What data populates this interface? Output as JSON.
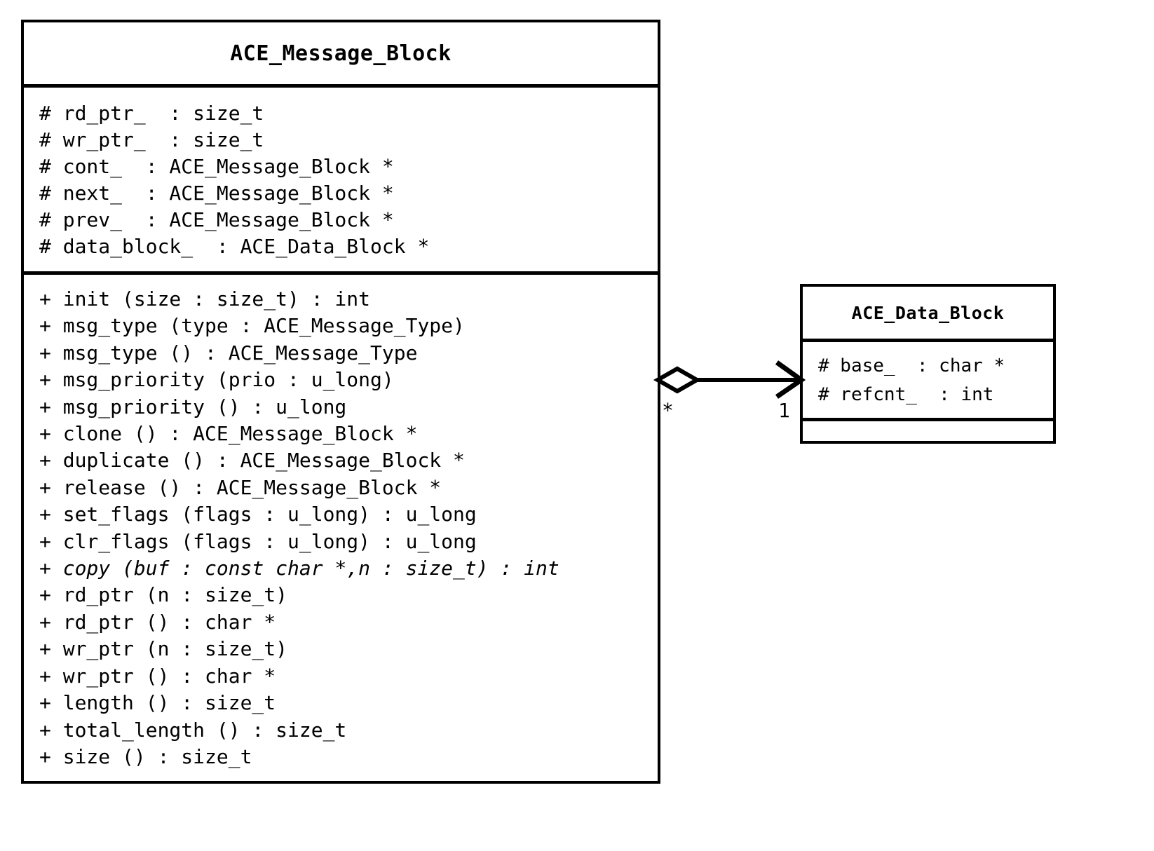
{
  "diagram": {
    "type": "uml-class-diagram",
    "background_color": "#ffffff",
    "line_color": "#000000"
  },
  "classes": {
    "message_block": {
      "name": "ACE_Message_Block",
      "attributes": [
        "# rd_ptr_  : size_t",
        "# wr_ptr_  : size_t",
        "# cont_  : ACE_Message_Block *",
        "# next_  : ACE_Message_Block *",
        "# prev_  : ACE_Message_Block *",
        "# data_block_  : ACE_Data_Block *"
      ],
      "operations": [
        {
          "text": "+ init (size : size_t) : int",
          "italic": false
        },
        {
          "text": "+ msg_type (type : ACE_Message_Type)",
          "italic": false
        },
        {
          "text": "+ msg_type () : ACE_Message_Type",
          "italic": false
        },
        {
          "text": "+ msg_priority (prio : u_long)",
          "italic": false
        },
        {
          "text": "+ msg_priority () : u_long",
          "italic": false
        },
        {
          "text": "+ clone () : ACE_Message_Block *",
          "italic": false
        },
        {
          "text": "+ duplicate () : ACE_Message_Block *",
          "italic": false
        },
        {
          "text": "+ release () : ACE_Message_Block *",
          "italic": false
        },
        {
          "text": "+ set_flags (flags : u_long) : u_long",
          "italic": false
        },
        {
          "text": "+ clr_flags (flags : u_long) : u_long",
          "italic": false
        },
        {
          "text": "+ copy (buf : const char *,n : size_t) : int",
          "italic": true
        },
        {
          "text": "+ rd_ptr (n : size_t)",
          "italic": false
        },
        {
          "text": "+ rd_ptr () : char *",
          "italic": false
        },
        {
          "text": "+ wr_ptr (n : size_t)",
          "italic": false
        },
        {
          "text": "+ wr_ptr () : char *",
          "italic": false
        },
        {
          "text": "+ length () : size_t",
          "italic": false
        },
        {
          "text": "+ total_length () : size_t",
          "italic": false
        },
        {
          "text": "+ size () : size_t",
          "italic": false
        }
      ]
    },
    "data_block": {
      "name": "ACE_Data_Block",
      "attributes": [
        "# base_  : char *",
        "# refcnt_  : int"
      ],
      "operations": []
    }
  },
  "relationship": {
    "kind": "aggregation",
    "source_class": "ACE_Message_Block",
    "target_class": "ACE_Data_Block",
    "source_multiplicity": "*",
    "target_multiplicity": "1",
    "source_decoration": "hollow-diamond",
    "target_decoration": "open-arrowhead"
  }
}
